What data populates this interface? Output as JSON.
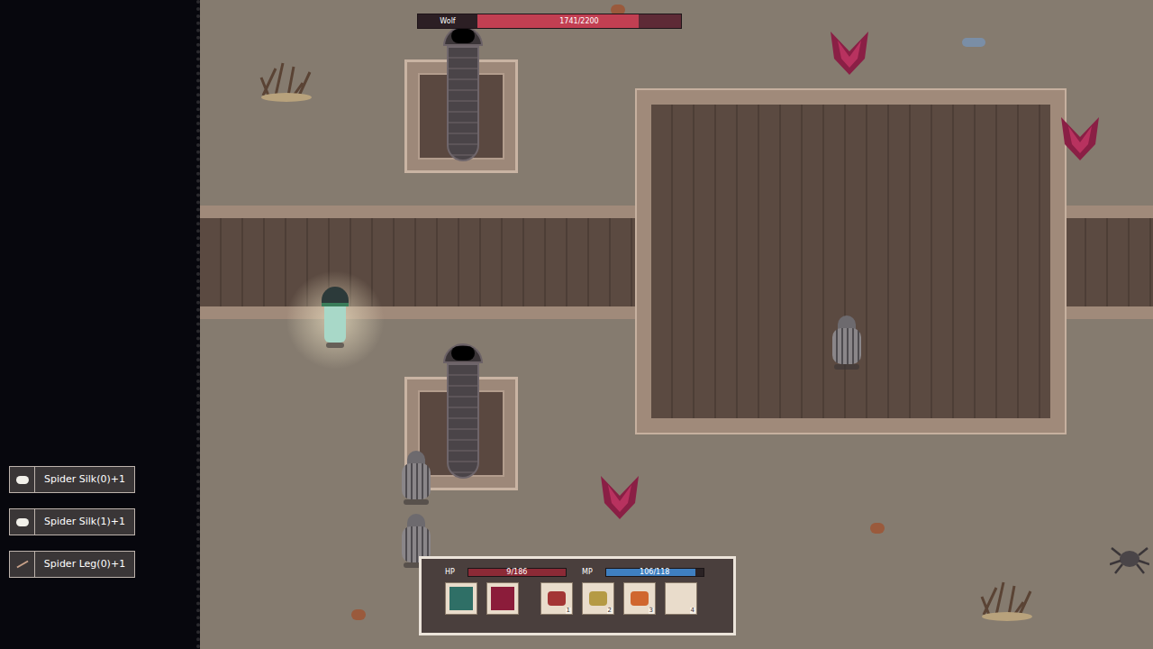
{
  "boss": {
    "name": "Wolf",
    "reading": "1741/2200",
    "level": 0.79
  },
  "notifications": [
    {
      "item": "Spider Silk(0)+1",
      "kind": "silk"
    },
    {
      "item": "Spider Silk(1)+1",
      "kind": "silk"
    },
    {
      "item": "Spider Leg(0)+1",
      "kind": "leg"
    }
  ],
  "hud": {
    "hp": {
      "label": "HP",
      "reading": "9/186",
      "level": 1,
      "color": "#8c2a36"
    },
    "mp": {
      "label": "MP",
      "reading": "106/118",
      "level": 0.92,
      "color": "#3f7fc0"
    }
  },
  "skills": [
    {
      "color": "#2f6f66"
    },
    {
      "color": "#8b1c3a"
    }
  ],
  "items": [
    {
      "key": "1",
      "empty": false,
      "color": "#a33535"
    },
    {
      "key": "2",
      "empty": false,
      "color": "#b59a45"
    },
    {
      "key": "3",
      "empty": false,
      "color": "#d0662e"
    },
    {
      "key": "4",
      "empty": true,
      "color": "#e9dccb"
    }
  ]
}
